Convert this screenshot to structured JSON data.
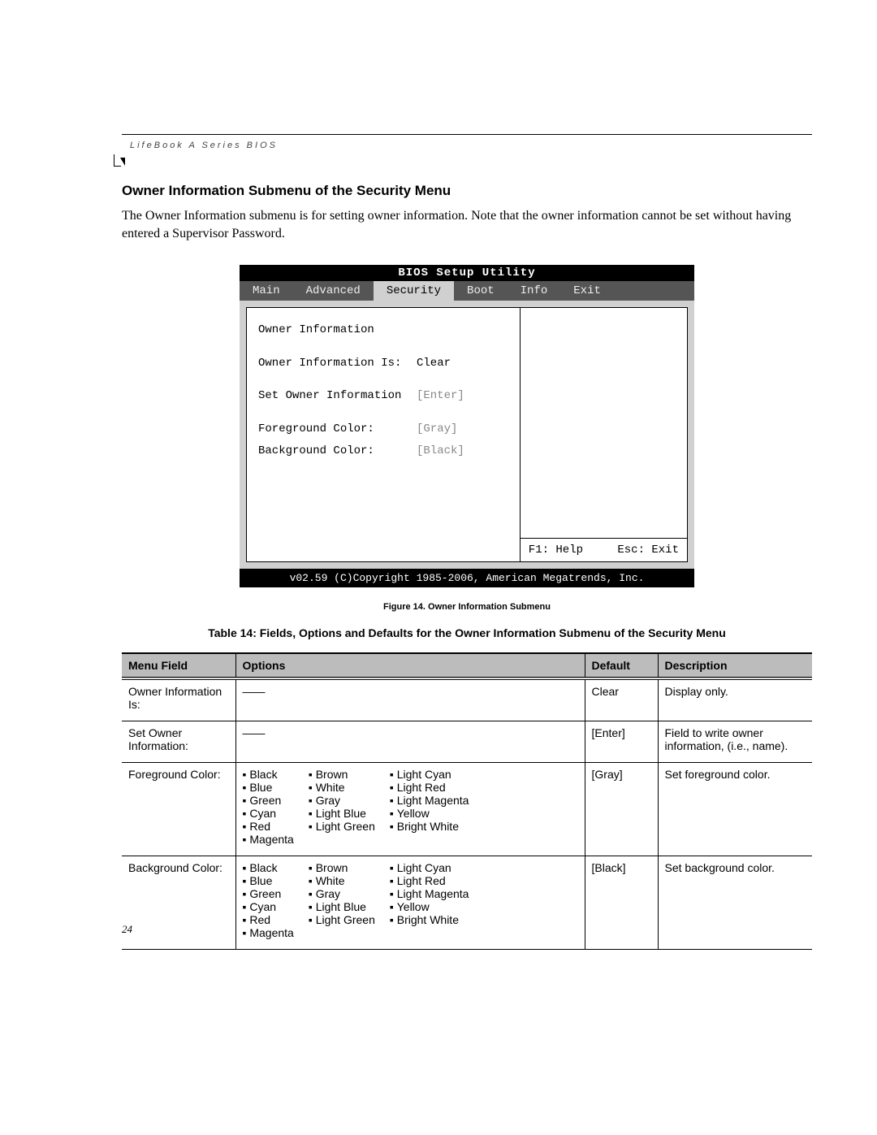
{
  "running_head": "LifeBook A Series BIOS",
  "section_title": "Owner Information Submenu of the Security Menu",
  "intro_text": "The Owner Information submenu is for setting owner information. Note that the owner information cannot be set without having entered a Supervisor Password.",
  "bios": {
    "titlebar": "BIOS Setup Utility",
    "tabs": [
      "Main",
      "Advanced",
      "Security",
      "Boot",
      "Info",
      "Exit"
    ],
    "active_tab_index": 2,
    "panel_heading": "Owner Information",
    "rows": [
      {
        "label": "Owner Information Is:",
        "value": "Clear",
        "gray_value": false
      },
      {
        "label": "Set Owner Information",
        "value": "[Enter]",
        "gray_value": true
      },
      {
        "label": "Foreground Color:",
        "value": "[Gray]",
        "gray_value": true
      },
      {
        "label": "Background Color:",
        "value": "[Black]",
        "gray_value": true
      }
    ],
    "help_left": "F1: Help",
    "help_right": "Esc: Exit",
    "footer": "v02.59 (C)Copyright 1985-2006, American Megatrends, Inc."
  },
  "figure_caption": "Figure 14.   Owner Information Submenu",
  "table_caption": "Table 14: Fields, Options and Defaults for the Owner Information Submenu of the Security Menu",
  "table_headers": [
    "Menu Field",
    "Options",
    "Default",
    "Description"
  ],
  "color_columns": [
    [
      "Black",
      "Blue",
      "Green",
      "Cyan",
      "Red",
      "Magenta"
    ],
    [
      "Brown",
      "White",
      "Gray",
      "Light Blue",
      "Light Green"
    ],
    [
      "Light Cyan",
      "Light Red",
      "Light Magenta",
      "Yellow",
      "Bright White"
    ]
  ],
  "table_rows": [
    {
      "field": "Owner Information Is:",
      "options_type": "dash",
      "default": "Clear",
      "description": "Display only."
    },
    {
      "field": "Set Owner Information:",
      "options_type": "dash",
      "default": "[Enter]",
      "description": "Field to write owner information, (i.e., name)."
    },
    {
      "field": "Foreground Color:",
      "options_type": "colors",
      "default": "[Gray]",
      "description": "Set foreground color."
    },
    {
      "field": "Background Color:",
      "options_type": "colors",
      "default": "[Black]",
      "description": "Set background color."
    }
  ],
  "page_number": "24"
}
